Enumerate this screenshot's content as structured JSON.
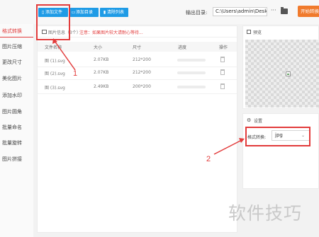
{
  "toolbar": {
    "add_file_label": "添加文件",
    "add_dir_label": "添加目录",
    "clear_list_label": "清除列表",
    "output_dir_label": "输出目录:",
    "output_dir_value": "C:\\Users\\admin\\Deskto",
    "browse_label": "···",
    "start_label": "开始转换"
  },
  "sidebar": {
    "items": [
      {
        "label": "格式转换",
        "active": true
      },
      {
        "label": "图片压缩"
      },
      {
        "label": "更改尺寸"
      },
      {
        "label": "美化图片"
      },
      {
        "label": "添加水印"
      },
      {
        "label": "图片圆角"
      },
      {
        "label": "批量命名"
      },
      {
        "label": "批量旋转"
      },
      {
        "label": "图片拼接"
      }
    ]
  },
  "file_panel": {
    "info_label": "图片信息（3个）",
    "info_note": "注意：如果图片较大请耐心等待...",
    "columns": [
      "文件名称",
      "大小",
      "尺寸",
      "进度",
      "操作"
    ],
    "rows": [
      {
        "name": "图 (1).svg",
        "size": "2.07KB",
        "dims": "212*200",
        "progress": 0
      },
      {
        "name": "图 (2).svg",
        "size": "2.07KB",
        "dims": "212*200",
        "progress": 0
      },
      {
        "name": "图 (3).svg",
        "size": "2.49KB",
        "dims": "200*200",
        "progress": 0
      }
    ]
  },
  "preview": {
    "title": "预览"
  },
  "settings": {
    "title": "设置",
    "format_label": "格式转换:",
    "format_value": "jpg"
  },
  "annotations": {
    "num1": "1",
    "num2": "2"
  },
  "watermark": "软件技巧",
  "colors": {
    "accent_blue": "#1e9be6",
    "start_orange": "#f07a2c",
    "highlight_red": "#e23b3b"
  }
}
